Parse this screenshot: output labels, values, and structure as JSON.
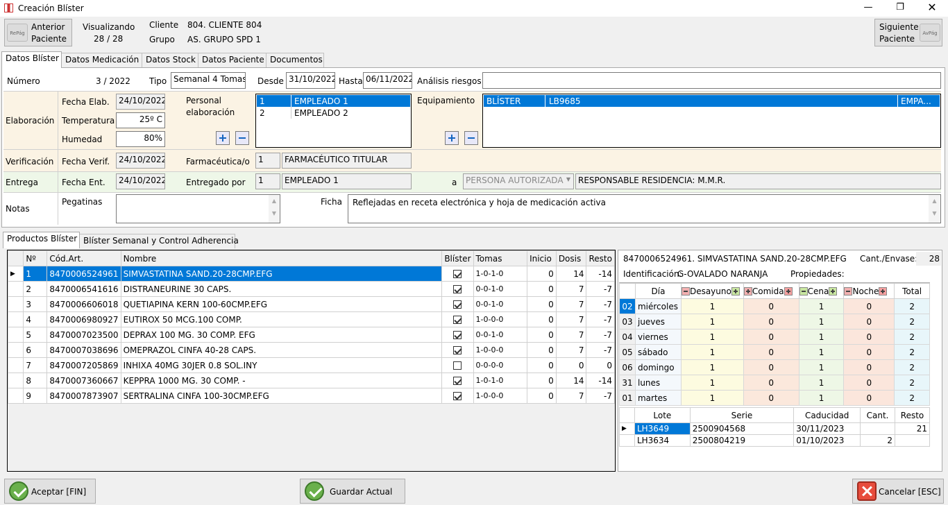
{
  "window": {
    "title": "Creación Blíster"
  },
  "nav": {
    "prev_line1": "Anterior",
    "prev_line2": "Paciente",
    "prev_icon_text": "RePág",
    "next_line1": "Siguiente",
    "next_line2": "Paciente",
    "next_icon_text": "AvPág",
    "viewing_label": "Visualizando",
    "viewing_value": "28 / 28",
    "client_label": "Cliente",
    "client_value": "804. CLIENTE 804",
    "group_label": "Grupo",
    "group_value": "AS. GRUPO SPD 1"
  },
  "tabs": [
    "Datos Blíster",
    "Datos Medicación",
    "Datos Stock",
    "Datos Paciente",
    "Documentos"
  ],
  "blister": {
    "numero_label": "Número",
    "numero_value": "3 / 2022",
    "tipo_label": "Tipo",
    "tipo_value": "Semanal 4 Tomas",
    "desde_label": "Desde",
    "desde_value": "31/10/2022",
    "hasta_label": "Hasta",
    "hasta_value": "06/11/2022",
    "riesgos_label": "Análisis riesgos",
    "riesgos_value": ""
  },
  "elaboracion": {
    "section_label": "Elaboración",
    "fecha_label": "Fecha Elab.",
    "fecha_value": "24/10/2022",
    "temp_label": "Temperatura",
    "temp_value": "25º C",
    "hum_label": "Humedad",
    "hum_value": "80%",
    "personal_label_1": "Personal",
    "personal_label_2": "elaboración",
    "personal": [
      {
        "id": "1",
        "name": "EMPLEADO 1"
      },
      {
        "id": "2",
        "name": "EMPLEADO 2"
      }
    ],
    "equip_label": "Equipamiento",
    "equip": [
      {
        "type": "BLÍSTER",
        "code": "LB9685",
        "extra": "EMPA..."
      }
    ]
  },
  "verificacion": {
    "section_label": "Verificación",
    "fecha_label": "Fecha Verif.",
    "fecha_value": "24/10/2022",
    "farm_label": "Farmacéutica/o",
    "farm_id": "1",
    "farm_name": "FARMACÉUTICO TITULAR"
  },
  "entrega": {
    "section_label": "Entrega",
    "fecha_label": "Fecha Ent.",
    "fecha_value": "24/10/2022",
    "por_label": "Entregado por",
    "por_id": "1",
    "por_name": "EMPLEADO 1",
    "a_label": "a",
    "a_select": "PERSONA AUTORIZADA",
    "a_value": "RESPONSABLE RESIDENCIA: M.M.R."
  },
  "notas": {
    "section_label": "Notas",
    "pegatinas_label": "Pegatinas",
    "pegatinas_value": "",
    "ficha_label": "Ficha",
    "ficha_value": "Reflejadas en receta electrónica y hoja de medicación activa"
  },
  "subtabs": [
    "Productos Blíster",
    "Blíster Semanal y Control Adherencia"
  ],
  "products": {
    "headers": [
      "Nº",
      "Cód.Art.",
      "Nombre",
      "Blíster",
      "Tomas",
      "Inicio",
      "Dosis",
      "Resto"
    ],
    "rows": [
      {
        "n": "1",
        "code": "8470006524961",
        "name": "SIMVASTATINA SAND.20-28CMP.EFG",
        "blister": true,
        "tomas": "1-0-1-0",
        "inicio": "0",
        "dosis": "14",
        "resto": "-14"
      },
      {
        "n": "2",
        "code": "8470006541616",
        "name": "DISTRANEURINE  30 CAPS.",
        "blister": true,
        "tomas": "0-0-1-0",
        "inicio": "0",
        "dosis": "7",
        "resto": "-7"
      },
      {
        "n": "3",
        "code": "8470006606018",
        "name": "QUETIAPINA KERN 100-60CMP.EFG",
        "blister": true,
        "tomas": "0-0-1-0",
        "inicio": "0",
        "dosis": "7",
        "resto": "-7"
      },
      {
        "n": "4",
        "code": "8470006980927",
        "name": "EUTIROX  50 MCG.100 COMP.",
        "blister": true,
        "tomas": "1-0-0-0",
        "inicio": "0",
        "dosis": "7",
        "resto": "-7"
      },
      {
        "n": "5",
        "code": "8470007023500",
        "name": "DEPRAX 100 MG. 30 COMP. EFG",
        "blister": true,
        "tomas": "0-0-1-0",
        "inicio": "0",
        "dosis": "7",
        "resto": "-7"
      },
      {
        "n": "6",
        "code": "8470007038696",
        "name": "OMEPRAZOL CINFA 40-28 CAPS.",
        "blister": true,
        "tomas": "1-0-0-0",
        "inicio": "0",
        "dosis": "7",
        "resto": "-7"
      },
      {
        "n": "7",
        "code": "8470007205869",
        "name": "INHIXA  40MG 30JER 0.8 SOL.INY",
        "blister": false,
        "tomas": "0-0-0-0",
        "inicio": "0",
        "dosis": "0",
        "resto": "0"
      },
      {
        "n": "8",
        "code": "8470007360667",
        "name": "KEPPRA 1000 MG. 30 COMP.      -",
        "blister": true,
        "tomas": "1-0-1-0",
        "inicio": "0",
        "dosis": "14",
        "resto": "-14"
      },
      {
        "n": "9",
        "code": "8470007873907",
        "name": "SERTRALINA CINFA 100-30CMP.EFG",
        "blister": true,
        "tomas": "1-0-0-0",
        "inicio": "0",
        "dosis": "7",
        "resto": "-7"
      }
    ]
  },
  "detail": {
    "product": "8470006524961. SIMVASTATINA SAND.20-28CMP.EFG",
    "cant_label": "Cant./Envase:",
    "cant_value": "28",
    "ident_label": "Identificación:",
    "ident_value": "G-OVALADO NARANJA",
    "prop_label": "Propiedades:",
    "prop_value": "",
    "schedule_headers": [
      "Día",
      "Desayuno",
      "Comida",
      "Cena",
      "Noche",
      "Total"
    ],
    "schedule": [
      {
        "num": "02",
        "day": "miércoles",
        "d": "1",
        "c": "0",
        "ce": "1",
        "n": "0",
        "t": "2"
      },
      {
        "num": "03",
        "day": "jueves",
        "d": "1",
        "c": "0",
        "ce": "1",
        "n": "0",
        "t": "2"
      },
      {
        "num": "04",
        "day": "viernes",
        "d": "1",
        "c": "0",
        "ce": "1",
        "n": "0",
        "t": "2"
      },
      {
        "num": "05",
        "day": "sábado",
        "d": "1",
        "c": "0",
        "ce": "1",
        "n": "0",
        "t": "2"
      },
      {
        "num": "06",
        "day": "domingo",
        "d": "1",
        "c": "0",
        "ce": "1",
        "n": "0",
        "t": "2"
      },
      {
        "num": "31",
        "day": "lunes",
        "d": "1",
        "c": "0",
        "ce": "1",
        "n": "0",
        "t": "2"
      },
      {
        "num": "01",
        "day": "martes",
        "d": "1",
        "c": "0",
        "ce": "1",
        "n": "0",
        "t": "2"
      }
    ],
    "lot_headers": [
      "Lote",
      "Serie",
      "Caducidad",
      "Cant.",
      "Resto"
    ],
    "lots": [
      {
        "lote": "LH3649",
        "serie": "2500904568",
        "cad": "30/11/2023",
        "cant": "",
        "resto": "21"
      },
      {
        "lote": "LH3634",
        "serie": "2500804219",
        "cad": "01/10/2023",
        "cant": "2",
        "resto": ""
      }
    ]
  },
  "footer": {
    "accept": "Aceptar [FIN]",
    "save": "Guardar Actual",
    "cancel": "Cancelar [ESC]"
  },
  "colors": {
    "select": "#0078d7",
    "elab_bg": "#fbf3e4",
    "entrega_bg": "#eef7e8",
    "desayuno": "#fdfbe0",
    "comida": "#fbe8dc",
    "cena": "#eef7e6",
    "noche": "#fbe6dc",
    "total": "#e8f6fa"
  }
}
